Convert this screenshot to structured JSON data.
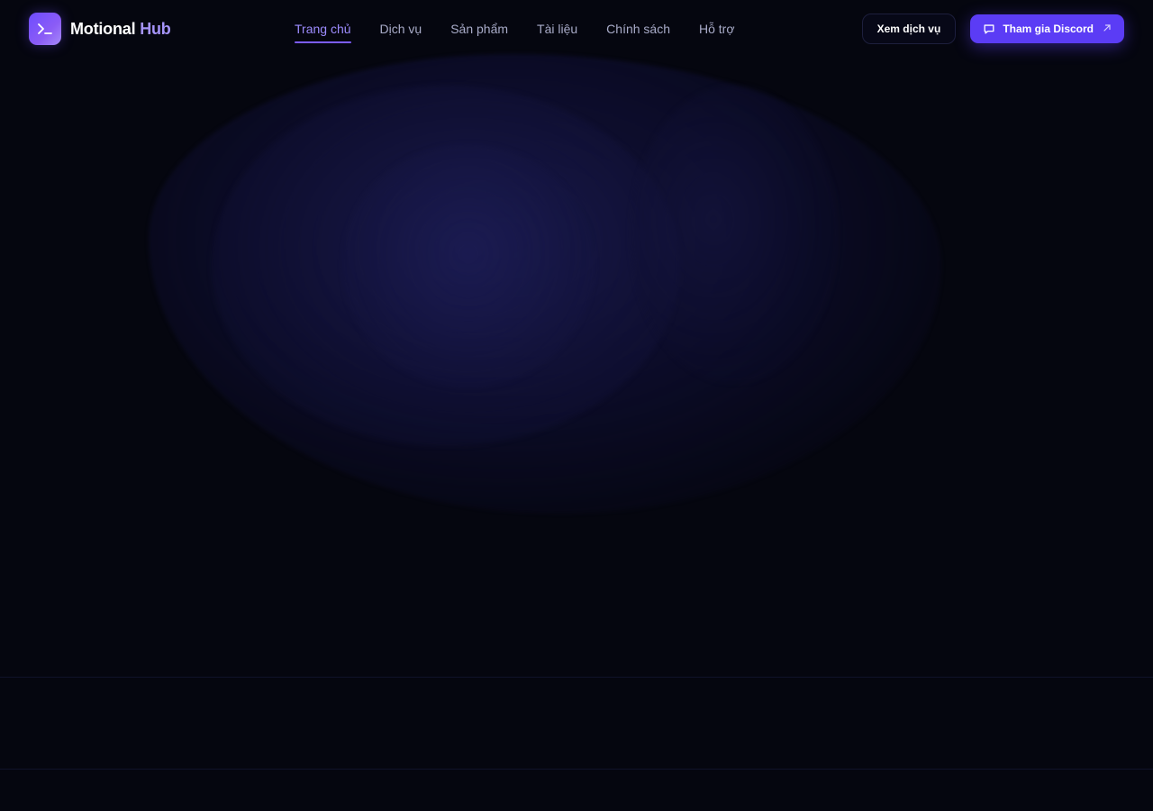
{
  "brand": {
    "name_main": "Motional",
    "name_accent": "Hub",
    "logo_icon": "terminal-prompt-icon",
    "accent_color": "#a594f9",
    "logo_gradient": [
      "#6d4cff",
      "#a78bfa"
    ]
  },
  "nav": {
    "items": [
      {
        "label": "Trang chủ",
        "active": true
      },
      {
        "label": "Dịch vụ",
        "active": false
      },
      {
        "label": "Sản phẩm",
        "active": false
      },
      {
        "label": "Tài liệu",
        "active": false
      },
      {
        "label": "Chính sách",
        "active": false
      },
      {
        "label": "Hỗ trợ",
        "active": false
      }
    ],
    "active_color": "#9d8cff",
    "inactive_color": "#a8abc8"
  },
  "actions": {
    "secondary_label": "Xem dịch vụ",
    "primary_label": "Tham gia Discord",
    "primary_icon": "message-square-icon",
    "primary_trailing_icon": "arrow-up-right-icon",
    "primary_color": "#5b3cf5"
  },
  "theme": {
    "background": "#05060f",
    "border": "#10122a"
  }
}
